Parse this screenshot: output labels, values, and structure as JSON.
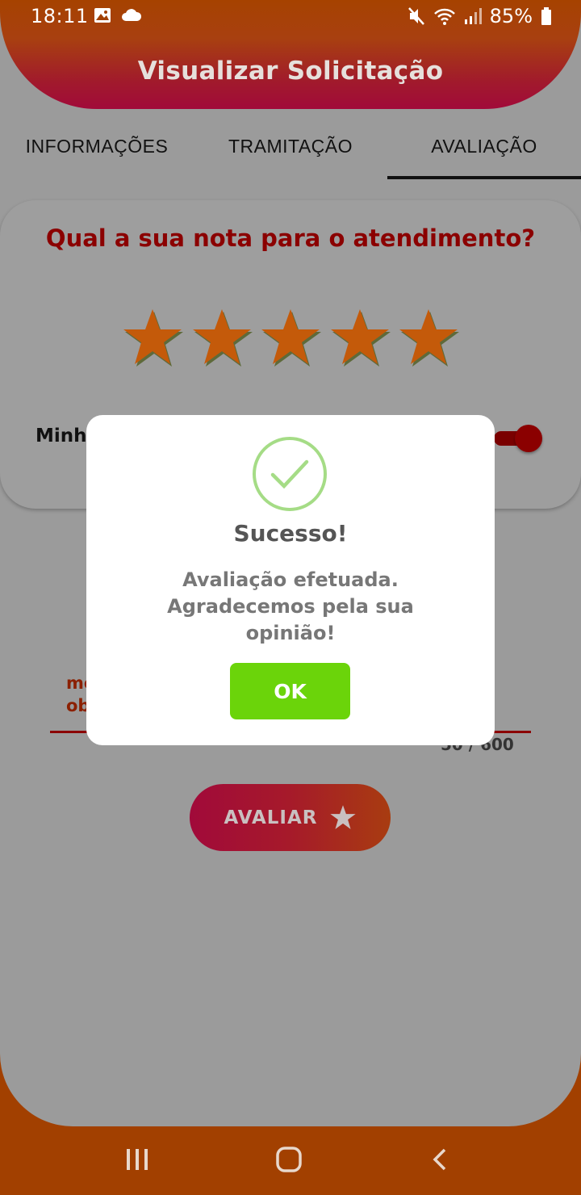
{
  "status_bar": {
    "time": "18:11",
    "battery": "85%",
    "left_icons": [
      "image-icon",
      "cloud-icon"
    ],
    "right_icons": [
      "mute-icon",
      "wifi-icon",
      "signal-icon",
      "battery-icon"
    ]
  },
  "header": {
    "title": "Visualizar Solicitação"
  },
  "tabs": [
    {
      "label": "INFORMAÇÕES",
      "active": false
    },
    {
      "label": "TRAMITAÇÃO",
      "active": false
    },
    {
      "label": "AVALIAÇÃO",
      "active": true
    }
  ],
  "rating": {
    "question": "Qual a sua nota para o atendimento?",
    "stars_selected": 5,
    "stars_total": 5,
    "star_color": "#c45a0a"
  },
  "toggle": {
    "label_visible": "Minh",
    "on": true
  },
  "textarea": {
    "hint_visible": "me\nob",
    "counter": "50 / 600"
  },
  "evaluate_button": {
    "label": "AVALIAR",
    "icon": "star-icon"
  },
  "dialog": {
    "icon": "check-circle-icon",
    "title": "Sucesso!",
    "message": "Avaliação efetuada. Agradecemos pela sua opinião!",
    "ok_label": "OK",
    "ok_color": "#6bd40a"
  },
  "nav": {
    "buttons": [
      "recents-icon",
      "home-icon",
      "back-icon"
    ]
  },
  "colors": {
    "brand_orange": "#a24000",
    "brand_red": "#a10a3a",
    "overlay_gray": "#9b9b9b"
  }
}
